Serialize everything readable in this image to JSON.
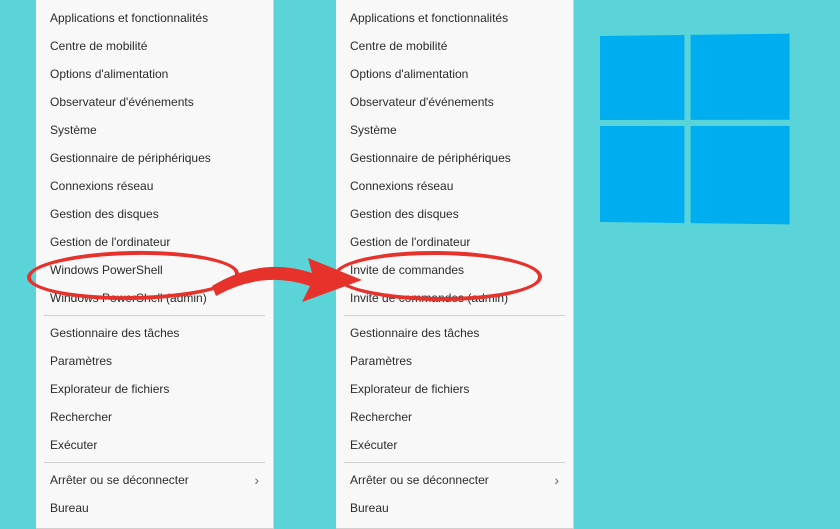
{
  "colors": {
    "background": "#5bd4d9",
    "menu_bg": "#f8f8f8",
    "accent_red": "#e6322b",
    "windows_blue": "#00aeef"
  },
  "left_menu": {
    "group1": [
      "Applications et fonctionnalités",
      "Centre de mobilité",
      "Options d'alimentation",
      "Observateur d'événements",
      "Système",
      "Gestionnaire de périphériques",
      "Connexions réseau",
      "Gestion des disques",
      "Gestion de l'ordinateur",
      "Windows PowerShell",
      "Windows PowerShell (admin)"
    ],
    "group2": [
      "Gestionnaire des tâches",
      "Paramètres",
      "Explorateur de fichiers",
      "Rechercher",
      "Exécuter"
    ],
    "group3": [
      "Arrêter ou se déconnecter",
      "Bureau"
    ]
  },
  "right_menu": {
    "group1": [
      "Applications et fonctionnalités",
      "Centre de mobilité",
      "Options d'alimentation",
      "Observateur d'événements",
      "Système",
      "Gestionnaire de périphériques",
      "Connexions réseau",
      "Gestion des disques",
      "Gestion de l'ordinateur",
      "Invite de commandes",
      "Invite de commandes (admin)"
    ],
    "group2": [
      "Gestionnaire des tâches",
      "Paramètres",
      "Explorateur de fichiers",
      "Rechercher",
      "Exécuter"
    ],
    "group3": [
      "Arrêter ou se déconnecter",
      "Bureau"
    ]
  },
  "highlighted_in_left": [
    "Windows PowerShell",
    "Windows PowerShell (admin)"
  ],
  "highlighted_in_right": [
    "Invite de commandes",
    "Invite de commandes (admin)"
  ],
  "submenu_items": [
    "Arrêter ou se déconnecter"
  ]
}
